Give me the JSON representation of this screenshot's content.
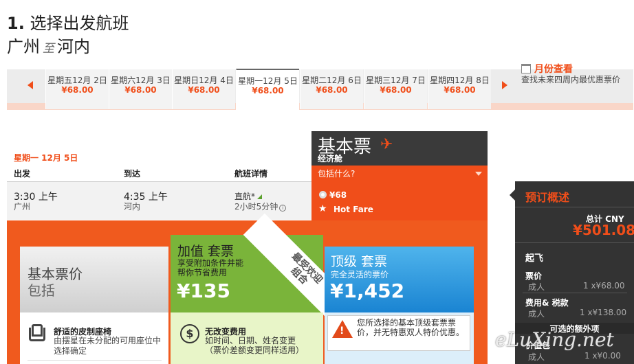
{
  "header": {
    "step_number": "1.",
    "step_title": "选择出发航班",
    "origin": "广州",
    "route_connector": "至",
    "destination": "河内"
  },
  "date_strip": {
    "dates": [
      {
        "label": "星期五12月 2日",
        "price": "¥68.00"
      },
      {
        "label": "星期六12月 3日",
        "price": "¥68.00"
      },
      {
        "label": "星期日12月 4日",
        "price": "¥68.00"
      },
      {
        "label": "星期一12月 5日",
        "price": "¥68.00",
        "selected": true
      },
      {
        "label": "星期二12月 6日",
        "price": "¥68.00"
      },
      {
        "label": "星期三12月 7日",
        "price": "¥68.00"
      },
      {
        "label": "星期四12月 8日",
        "price": "¥68.00"
      }
    ],
    "month_view_label": "月份查看",
    "month_view_sub": "查找未来四周内最优惠票价"
  },
  "flight_table": {
    "date_label": "星期一 12月 5日",
    "col_depart": "出发",
    "col_arrive": "到达",
    "col_details": "航班详情",
    "row": {
      "dep_time": "3:30 上午",
      "dep_city": "广州",
      "arr_time": "4:35 上午",
      "arr_city": "河内",
      "stops": "直航*",
      "duration": "2小时5分钟"
    }
  },
  "fare_column": {
    "title": "基本票",
    "cabin": "经济舱",
    "includes_label": "包括什么?",
    "price": "¥68",
    "tag": "Hot Fare"
  },
  "bundles": {
    "basic": {
      "title": "基本票价",
      "subtitle": "包括",
      "feature_title": "舒适的皮制座椅",
      "feature_desc": "由摆星在未分配的可用座位中选择确定"
    },
    "value": {
      "title": "加值 套票",
      "desc_line1": "享受附加条件并能",
      "desc_line2": "帮你节省费用",
      "price": "¥135",
      "ribbon_line1": "最受欢迎",
      "ribbon_line2": "组合",
      "feature_title": "无改变费用",
      "feature_line1": "如时间、日期、姓名变更",
      "feature_line2": "（票价差额变更同样适用）"
    },
    "premium": {
      "title": "顶级 套票",
      "desc": "完全灵活的票价",
      "price": "¥1,452",
      "warning": "您所选择的基本顶级套票票价，并无特惠双人特价优惠。"
    }
  },
  "summary": {
    "title": "预订概述",
    "total_label": "总计 CNY",
    "total_value": "¥501.08",
    "departure_label": "起飞",
    "fare_label": "票价",
    "fare_adult": "成人",
    "fare_qty": "1 x¥68.00",
    "fees_label": "费用& 税款",
    "fees_adult": "成人",
    "fees_qty": "1 x¥138.00",
    "extras_label": "可选的额外项",
    "extras_price_label": "价值包",
    "extras_adult": "成人",
    "extras_qty": "1 x¥0.00"
  },
  "watermark": "eLuXing.net",
  "colors": {
    "accent": "#f04e1a",
    "value_green": "#7ab43a",
    "premium_blue": "#1a84d2",
    "panel_dark": "#333333"
  }
}
